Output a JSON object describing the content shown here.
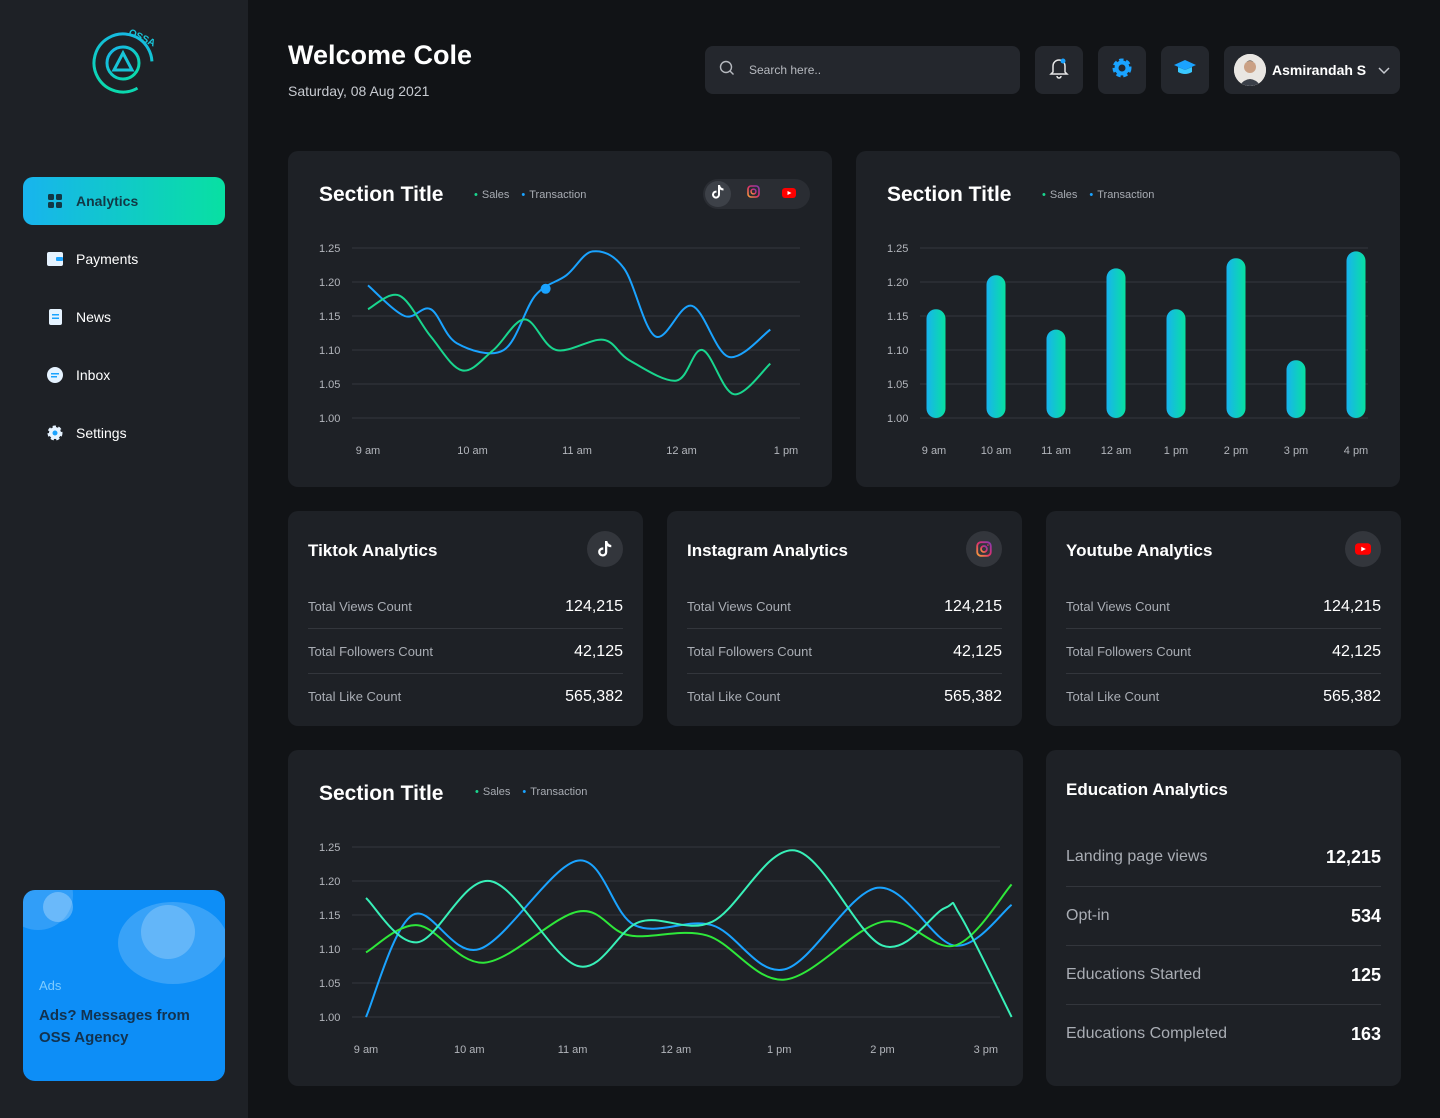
{
  "brand": {
    "logo_text": "OSSA"
  },
  "sidebar": {
    "items": [
      {
        "label": "Analytics",
        "icon": "grid-icon",
        "active": true
      },
      {
        "label": "Payments",
        "icon": "wallet-icon",
        "active": false
      },
      {
        "label": "News",
        "icon": "document-icon",
        "active": false
      },
      {
        "label": "Inbox",
        "icon": "chat-icon",
        "active": false
      },
      {
        "label": "Settings",
        "icon": "gear-icon",
        "active": false
      }
    ],
    "ads": {
      "tag": "Ads",
      "message": "Ads? Messages from OSS Agency"
    }
  },
  "header": {
    "welcome": "Welcome Cole",
    "date": "Saturday, 08 Aug 2021",
    "search_placeholder": "Search here..",
    "user_name": "Asmirandah S"
  },
  "legend": {
    "sales": "Sales",
    "transaction": "Transaction"
  },
  "colors": {
    "sales": "#19d68e",
    "transaction": "#1aa3ff",
    "accent_start": "#18b4ee",
    "accent_end": "#08e0a2"
  },
  "charts": {
    "line1": {
      "title": "Section Title"
    },
    "bar1": {
      "title": "Section Title"
    },
    "line2": {
      "title": "Section Title"
    }
  },
  "chart_data": [
    {
      "type": "line",
      "title": "Section Title",
      "x": [
        "9 am",
        "10 am",
        "11 am",
        "12 am",
        "1 pm"
      ],
      "yticks": [
        "1.25",
        "1.20",
        "1.15",
        "1.10",
        "1.05",
        "1.00"
      ],
      "ylim": [
        1.0,
        1.25
      ],
      "series": [
        {
          "name": "Transaction",
          "points": [
            [
              0,
              1.195
            ],
            [
              0.35,
              1.15
            ],
            [
              0.6,
              1.16
            ],
            [
              0.85,
              1.11
            ],
            [
              1.3,
              1.1
            ],
            [
              1.6,
              1.18
            ],
            [
              1.9,
              1.21
            ],
            [
              2.15,
              1.245
            ],
            [
              2.45,
              1.22
            ],
            [
              2.75,
              1.12
            ],
            [
              3.1,
              1.165
            ],
            [
              3.45,
              1.09
            ],
            [
              3.85,
              1.13
            ]
          ]
        },
        {
          "name": "Sales",
          "points": [
            [
              0,
              1.16
            ],
            [
              0.3,
              1.18
            ],
            [
              0.6,
              1.12
            ],
            [
              0.9,
              1.07
            ],
            [
              1.2,
              1.1
            ],
            [
              1.5,
              1.145
            ],
            [
              1.8,
              1.1
            ],
            [
              2.25,
              1.115
            ],
            [
              2.5,
              1.085
            ],
            [
              2.95,
              1.055
            ],
            [
              3.2,
              1.1
            ],
            [
              3.5,
              1.035
            ],
            [
              3.85,
              1.08
            ]
          ]
        }
      ],
      "marker": {
        "series": "Transaction",
        "point": [
          1.7,
          1.19
        ]
      },
      "grid": true
    },
    {
      "type": "bar",
      "title": "Section Title",
      "categories": [
        "9 am",
        "10 am",
        "11 am",
        "12 am",
        "1 pm",
        "2 pm",
        "3 pm",
        "4 pm"
      ],
      "values": [
        1.16,
        1.21,
        1.13,
        1.22,
        1.16,
        1.235,
        1.085,
        1.245
      ],
      "yticks": [
        "1.25",
        "1.20",
        "1.15",
        "1.10",
        "1.05",
        "1.00"
      ],
      "ylim": [
        1.0,
        1.25
      ],
      "grid": true
    },
    {
      "type": "line",
      "title": "Section Title",
      "x": [
        "9 am",
        "10 am",
        "11 am",
        "12 am",
        "1 pm",
        "2 pm",
        "3 pm"
      ],
      "yticks": [
        "1.25",
        "1.20",
        "1.15",
        "1.10",
        "1.05",
        "1.00"
      ],
      "ylim": [
        1.0,
        1.25
      ],
      "series": [
        {
          "name": "Transaction",
          "color": "#1aa3ff",
          "points": [
            [
              0,
              1.0
            ],
            [
              0.45,
              1.15
            ],
            [
              1.1,
              1.1
            ],
            [
              2.05,
              1.23
            ],
            [
              2.6,
              1.135
            ],
            [
              3.35,
              1.135
            ],
            [
              4.05,
              1.07
            ],
            [
              4.95,
              1.19
            ],
            [
              5.7,
              1.105
            ],
            [
              6.25,
              1.165
            ]
          ]
        },
        {
          "name": "Sales",
          "color": "#2ee83a",
          "points": [
            [
              0,
              1.095
            ],
            [
              0.5,
              1.135
            ],
            [
              1.15,
              1.08
            ],
            [
              2.05,
              1.155
            ],
            [
              2.55,
              1.12
            ],
            [
              3.3,
              1.12
            ],
            [
              4.05,
              1.055
            ],
            [
              5.0,
              1.14
            ],
            [
              5.7,
              1.105
            ],
            [
              6.25,
              1.195
            ]
          ]
        },
        {
          "name": "Sales",
          "color": "#38f0b8",
          "points": [
            [
              0,
              1.175
            ],
            [
              0.5,
              1.11
            ],
            [
              1.2,
              1.2
            ],
            [
              2.05,
              1.075
            ],
            [
              2.65,
              1.14
            ],
            [
              3.35,
              1.14
            ],
            [
              4.15,
              1.245
            ],
            [
              5.0,
              1.105
            ],
            [
              5.6,
              1.16
            ],
            [
              5.75,
              1.15
            ],
            [
              6.25,
              1.0
            ]
          ]
        }
      ],
      "grid": true
    }
  ],
  "social": {
    "tiktok": {
      "title": "Tiktok Analytics",
      "rows": [
        {
          "label": "Total Views Count",
          "value": "124,215"
        },
        {
          "label": "Total Followers Count",
          "value": "42,125"
        },
        {
          "label": "Total Like Count",
          "value": "565,382"
        }
      ]
    },
    "instagram": {
      "title": "Instagram Analytics",
      "rows": [
        {
          "label": "Total Views Count",
          "value": "124,215"
        },
        {
          "label": "Total Followers Count",
          "value": "42,125"
        },
        {
          "label": "Total Like Count",
          "value": "565,382"
        }
      ]
    },
    "youtube": {
      "title": "Youtube Analytics",
      "rows": [
        {
          "label": "Total Views Count",
          "value": "124,215"
        },
        {
          "label": "Total Followers Count",
          "value": "42,125"
        },
        {
          "label": "Total Like Count",
          "value": "565,382"
        }
      ]
    }
  },
  "education": {
    "title": "Education Analytics",
    "rows": [
      {
        "label": "Landing page views",
        "value": "12,215"
      },
      {
        "label": "Opt-in",
        "value": "534"
      },
      {
        "label": "Educations Started",
        "value": "125"
      },
      {
        "label": "Educations Completed",
        "value": "163"
      }
    ]
  }
}
